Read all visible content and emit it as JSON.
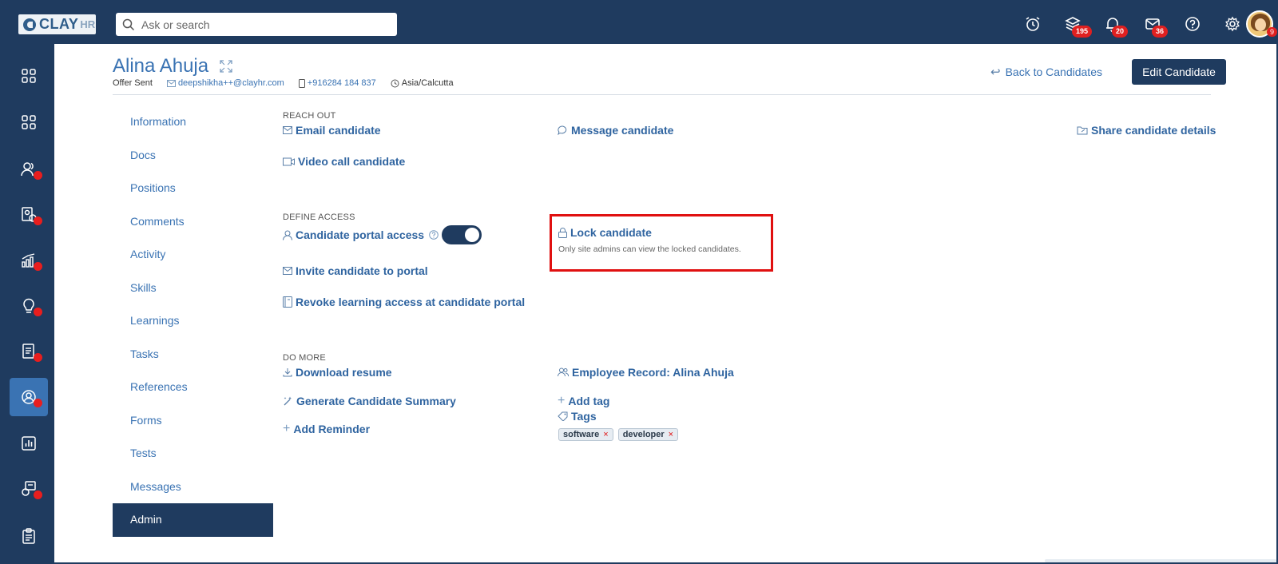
{
  "logo": {
    "primary": "CLAY",
    "secondary": "HR"
  },
  "search": {
    "placeholder": "Ask or search"
  },
  "top_icons": [
    {
      "name": "alarm-icon",
      "badge": ""
    },
    {
      "name": "layers-icon",
      "badge": "195"
    },
    {
      "name": "bell-icon",
      "badge": "20"
    },
    {
      "name": "mail-icon",
      "badge": "36"
    },
    {
      "name": "help-icon",
      "badge": ""
    },
    {
      "name": "gear-icon",
      "badge": ""
    }
  ],
  "avatar_badge": "9",
  "candidate": {
    "name": "Alina Ahuja",
    "status": "Offer Sent",
    "email": "deepshikha++@clayhr.com",
    "phone": "+916284 184 837",
    "timezone": "Asia/Calcutta"
  },
  "header": {
    "back_label": "Back to Candidates",
    "edit_label": "Edit Candidate"
  },
  "nav": [
    "Information",
    "Docs",
    "Positions",
    "Comments",
    "Activity",
    "Skills",
    "Learnings",
    "Tasks",
    "References",
    "Forms",
    "Tests",
    "Messages",
    "Admin"
  ],
  "reach_out": {
    "title": "REACH OUT",
    "email": "Email candidate",
    "message": "Message candidate",
    "share": "Share candidate details",
    "video": "Video call candidate"
  },
  "define_access": {
    "title": "DEFINE ACCESS",
    "portal_access": "Candidate portal access",
    "portal_access_enabled": true,
    "lock": "Lock candidate",
    "lock_desc": "Only site admins can view the locked candidates.",
    "invite": "Invite candidate to portal",
    "revoke": "Revoke learning access at candidate portal"
  },
  "do_more": {
    "title": "DO MORE",
    "download": "Download resume",
    "employee_record": "Employee Record: Alina Ahuja",
    "generate": "Generate Candidate Summary",
    "add_tag": "Add tag",
    "tags_label": "Tags",
    "add_reminder": "Add Reminder",
    "tags": [
      "software",
      "developer"
    ]
  },
  "colors": {
    "navy": "#1f3b5f",
    "link": "#3a73b3",
    "alert": "#e01010"
  }
}
